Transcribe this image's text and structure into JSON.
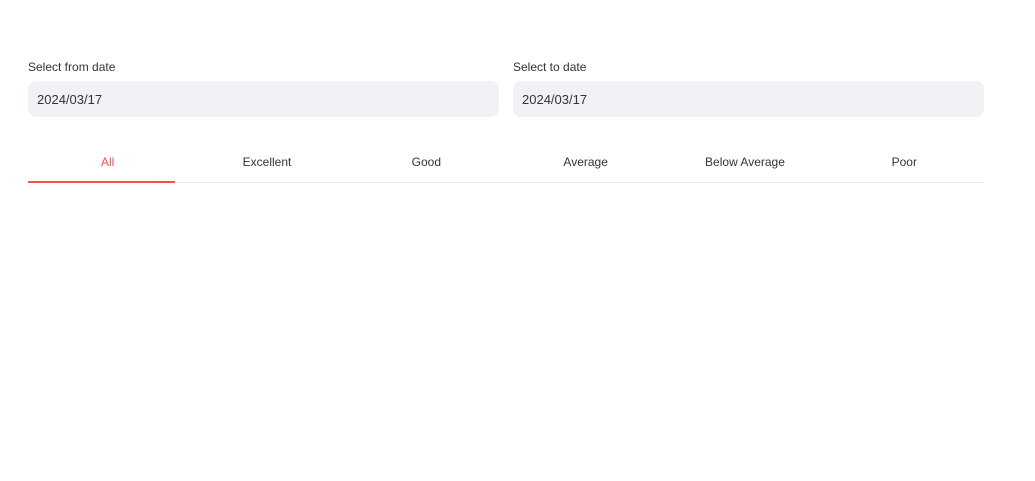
{
  "filters": {
    "from": {
      "label": "Select from date",
      "value": "2024/03/17"
    },
    "to": {
      "label": "Select to date",
      "value": "2024/03/17"
    }
  },
  "tabs": [
    {
      "label": "All",
      "active": true
    },
    {
      "label": "Excellent",
      "active": false
    },
    {
      "label": "Good",
      "active": false
    },
    {
      "label": "Average",
      "active": false
    },
    {
      "label": "Below Average",
      "active": false
    },
    {
      "label": "Poor",
      "active": false
    }
  ],
  "colors": {
    "accent": "#ff4b4b",
    "input_bg": "#f0f2f6",
    "text": "#31333f",
    "tab_border": "#e6e6ea"
  }
}
